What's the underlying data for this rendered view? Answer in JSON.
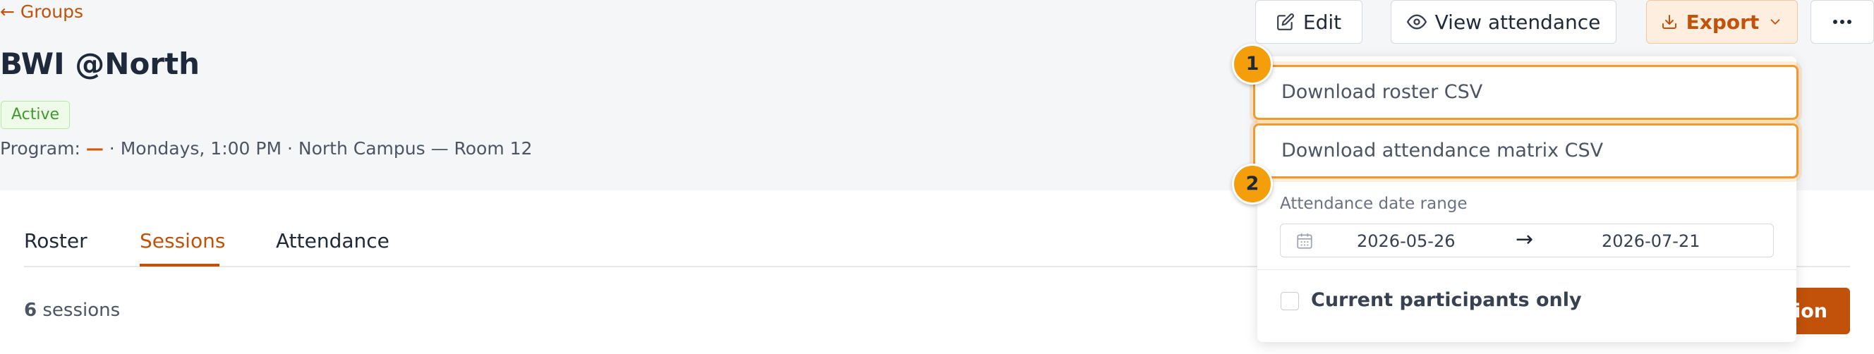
{
  "breadcrumb": {
    "back_label": "← Groups"
  },
  "group": {
    "title": "BWI @North",
    "status": "Active",
    "meta_prefix": "Program: ",
    "meta_program": "—",
    "meta_suffix": " · Mondays, 1:00 PM · North Campus — Room 12"
  },
  "toolbar": {
    "edit_label": "Edit",
    "view_attendance_label": "View attendance",
    "export_label": "Export",
    "more_label": "···"
  },
  "tabs": [
    {
      "label": "Roster"
    },
    {
      "label": "Sessions",
      "active": true
    },
    {
      "label": "Attendance"
    }
  ],
  "sessions": {
    "count": "6",
    "count_suffix": " sessions",
    "new_button_label": "sion"
  },
  "export_menu": {
    "items": [
      {
        "marker": "1",
        "label": "Download roster CSV"
      },
      {
        "marker": "2",
        "label": "Download attendance matrix CSV"
      }
    ],
    "date_range_label": "Attendance date range",
    "date_start": "2026-05-26",
    "date_arrow": "→",
    "date_end": "2026-07-21",
    "current_only_label": "Current participants only",
    "current_only_checked": false
  },
  "colors": {
    "accent": "#c2510a",
    "marker": "#f59e0b",
    "status_green": "#3e9a2a"
  }
}
